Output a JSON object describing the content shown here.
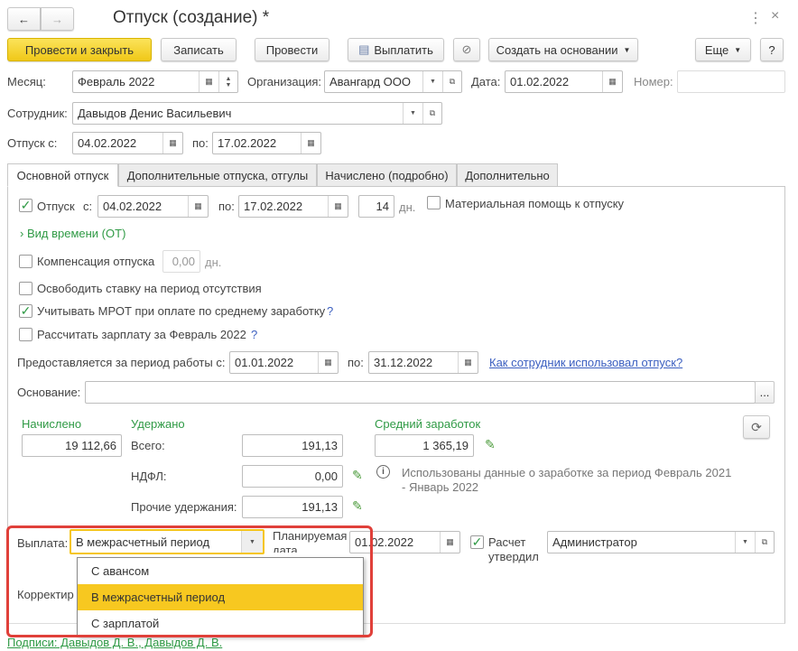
{
  "window": {
    "title": "Отпуск (создание) *",
    "back": "←",
    "forward": "→",
    "more": "⋮",
    "close": "×"
  },
  "toolbar": {
    "post_close": "Провести и закрыть",
    "save": "Записать",
    "post": "Провести",
    "pay": "Выплатить",
    "create_based": "Создать на основании",
    "more": "Еще",
    "help": "?"
  },
  "header": {
    "month_label": "Месяц:",
    "month": "Февраль 2022",
    "org_label": "Организация:",
    "org": "Авангард ООО",
    "date_label": "Дата:",
    "date": "01.02.2022",
    "number_label": "Номер:",
    "number": "",
    "employee_label": "Сотрудник:",
    "employee": "Давыдов Денис Васильевич",
    "vac_from_label": "Отпуск с:",
    "vac_from": "04.02.2022",
    "vac_to_label": "по:",
    "vac_to": "17.02.2022"
  },
  "tabs": [
    "Основной отпуск",
    "Дополнительные отпуска, отгулы",
    "Начислено (подробно)",
    "Дополнительно"
  ],
  "main": {
    "vacation_label": "Отпуск",
    "vacation_checked": true,
    "from_label": "с:",
    "from": "04.02.2022",
    "to_label": "по:",
    "to": "17.02.2022",
    "days": "14",
    "days_unit": "дн.",
    "material_help": "Материальная помощь к отпуску",
    "time_type": "Вид времени (ОТ)",
    "compensation": "Компенсация отпуска",
    "compensation_value": "0,00",
    "compensation_unit": "дн.",
    "free_rate": "Освободить ставку на период отсутствия",
    "mrot": "Учитывать МРОТ при оплате по среднему заработку",
    "mrot_help": "?",
    "calc_salary": "Рассчитать зарплату за Февраль 2022",
    "calc_help": "?",
    "period_label": "Предоставляется за период работы с:",
    "period_from": "01.01.2022",
    "period_to_label": "по:",
    "period_to": "31.12.2022",
    "period_link": "Как сотрудник использовал отпуск?",
    "basis_label": "Основание:",
    "basis": "",
    "basis_btn": "...",
    "accrued_label": "Начислено",
    "accrued": "19 112,66",
    "withheld_label": "Удержано",
    "total_label": "Всего:",
    "total": "191,13",
    "ndfl_label": "НДФЛ:",
    "ndfl": "0,00",
    "other_label": "Прочие удержания:",
    "other": "191,13",
    "avg_label": "Средний заработок",
    "avg": "1 365,19",
    "info_line1": "Использованы данные о заработке за период Февраль 2021",
    "info_line2": "- Январь 2022",
    "payout_label": "Выплата:",
    "payout": "В межрасчетный период",
    "planned_label_1": "Планируемая",
    "planned_label_2": "дата",
    "planned_date": "01.02.2022",
    "approved_label_1": "Расчет",
    "approved_label_2": "утвердил",
    "approved_checked": true,
    "approved_by": "Администратор",
    "correction_label": "Корректир"
  },
  "dropdown": {
    "options": [
      "С авансом",
      "В межрасчетный период",
      "С зарплатой"
    ],
    "selected": 1
  },
  "footer": {
    "signatures": "Подписи: Давыдов Д. В., Давыдов Д. В."
  }
}
